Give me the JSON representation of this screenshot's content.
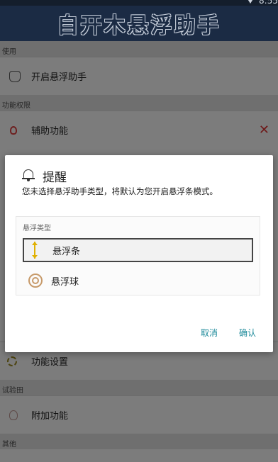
{
  "status": {
    "time": "8:55"
  },
  "header": {
    "title": "自开木悬浮助手"
  },
  "sections": {
    "use": "使用",
    "permissions": "功能权限",
    "trial": "试验田",
    "other": "其他"
  },
  "items": {
    "open_float": "开启悬浮助手",
    "accessibility": "辅助功能",
    "close_mark": "✕",
    "settings": "功能设置",
    "extra": "附加功能"
  },
  "dialog": {
    "title": "提醒",
    "message": "您未选择悬浮助手类型，将默认为您开启悬浮条模式。",
    "group_label": "悬浮类型",
    "options": [
      "悬浮条",
      "悬浮球"
    ],
    "selected_option": "悬浮条",
    "cancel_label": "取消",
    "confirm_label": "确认"
  },
  "colors": {
    "header_bg": "#1b2b44",
    "accent": "#1d8a9a",
    "bar_icon": "#e0b000",
    "ball_icon": "#c79a6a"
  },
  "icons": {
    "open_float": "hand-pointer-icon",
    "accessibility": "lightbulb-icon",
    "settings": "gear-icon",
    "extra": "lightbulb-icon",
    "dialog": "bell-icon",
    "bar": "vertical-bar-icon",
    "ball": "ball-icon"
  }
}
